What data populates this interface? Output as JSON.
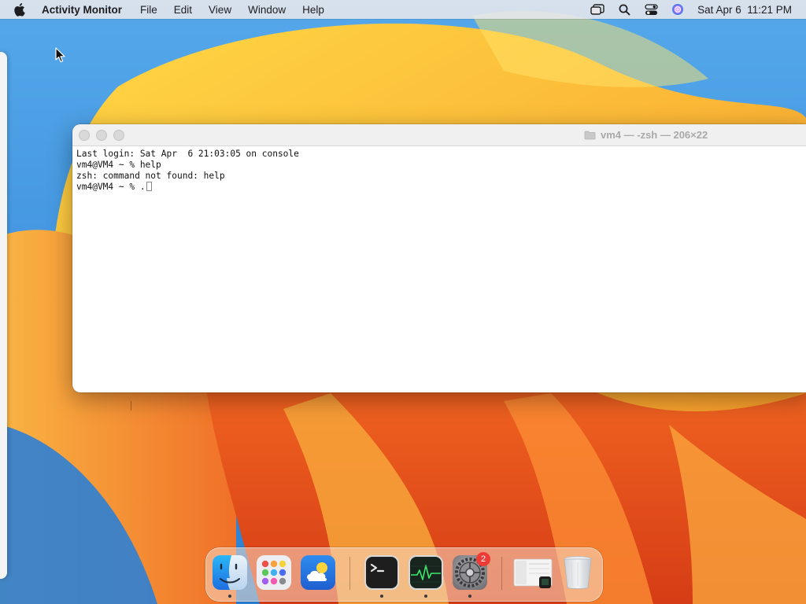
{
  "menubar": {
    "app_name": "Activity Monitor",
    "items": [
      "File",
      "Edit",
      "View",
      "Window",
      "Help"
    ],
    "clock": "Sat Apr 6  11:21 PM",
    "status_icons": [
      "window-stack-icon",
      "search-icon",
      "control-center-icon",
      "siri-icon"
    ]
  },
  "terminal": {
    "title": "vm4 — -zsh — 206×22",
    "lines": [
      "Last login: Sat Apr  6 21:03:05 on console",
      "vm4@VM4 ~ % help",
      "zsh: command not found: help"
    ],
    "prompt": "vm4@VM4 ~ % ."
  },
  "dock": {
    "apps": [
      {
        "name": "Finder",
        "icon": "finder-icon",
        "running": true
      },
      {
        "name": "Launchpad",
        "icon": "launchpad-icon",
        "running": false
      },
      {
        "name": "Weather",
        "icon": "weather-icon",
        "running": false
      },
      {
        "name": "Terminal",
        "icon": "terminal-icon",
        "running": true
      },
      {
        "name": "Activity Monitor",
        "icon": "activity-monitor-icon",
        "running": true
      },
      {
        "name": "System Settings",
        "icon": "system-settings-icon",
        "running": true,
        "badge": "2"
      },
      {
        "name": "Recent Window",
        "icon": "window-thumbnail-icon",
        "running": false
      },
      {
        "name": "Trash",
        "icon": "trash-icon",
        "running": false
      }
    ]
  },
  "colors": {
    "badge": "#ef3b35",
    "terminal_bg": "#ffffff",
    "menubar_bg": "#e8e8ec"
  }
}
